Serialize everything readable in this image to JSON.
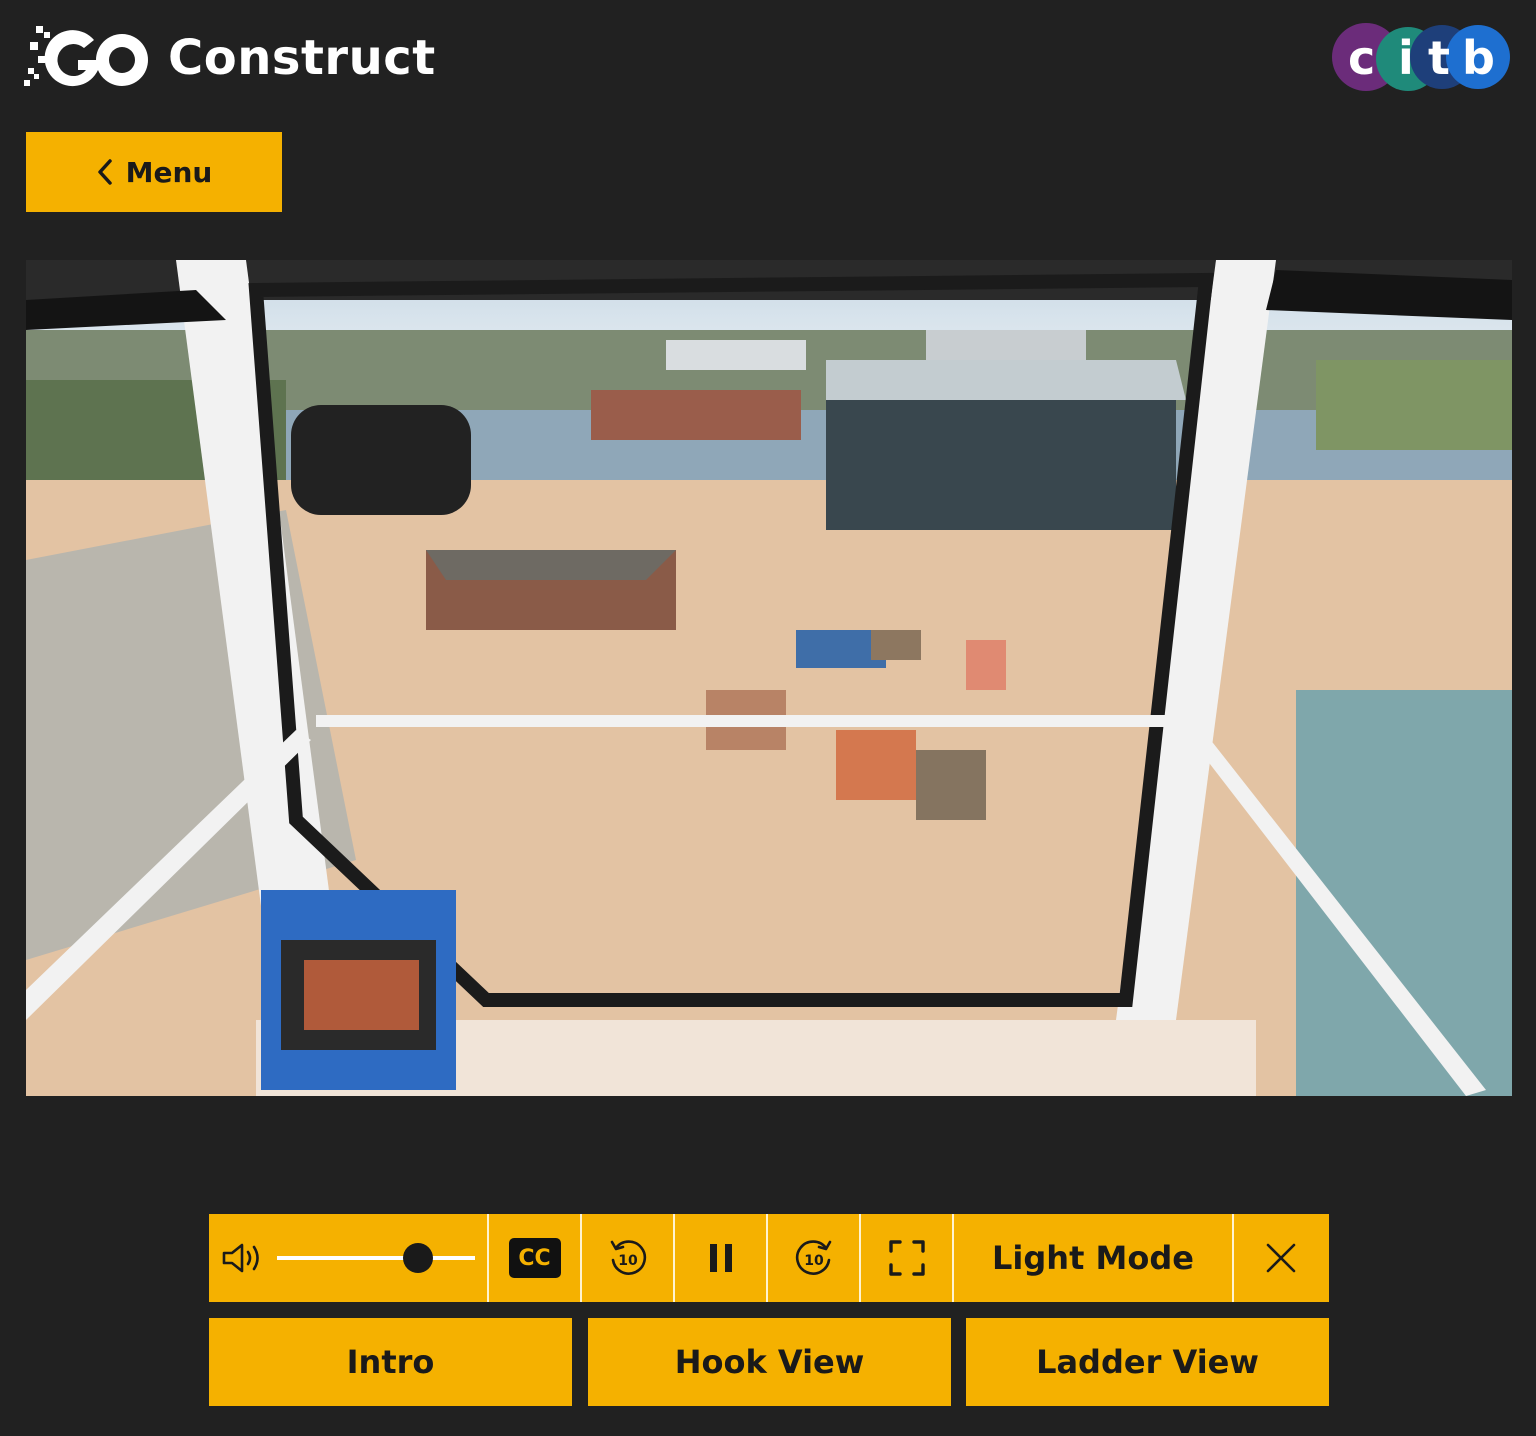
{
  "header": {
    "brand_prefix": "GO",
    "brand_name": "Construct",
    "partner_logo": "citb"
  },
  "nav": {
    "menu_label": "Menu",
    "menu_icon": "chevron-left-icon"
  },
  "video": {
    "description_icon": "video-frame",
    "state": "playing"
  },
  "player_controls": {
    "volume_icon": "speaker-icon",
    "volume_level": 0.75,
    "captions_label": "CC",
    "rewind_label": "10",
    "forward_label": "10",
    "pause_icon": "pause-icon",
    "fullscreen_icon": "fullscreen-icon",
    "light_mode_label": "Light Mode",
    "close_icon": "close-icon"
  },
  "views": [
    {
      "label": "Intro"
    },
    {
      "label": "Hook View"
    },
    {
      "label": "Ladder View"
    }
  ],
  "colors": {
    "background": "#212121",
    "accent": "#f5b100",
    "text_dark": "#1a1a1a",
    "citb_purple": "#6b2c7a",
    "citb_teal": "#1f8a7a",
    "citb_navy": "#1e3f7a",
    "citb_blue": "#1e6fd0"
  }
}
